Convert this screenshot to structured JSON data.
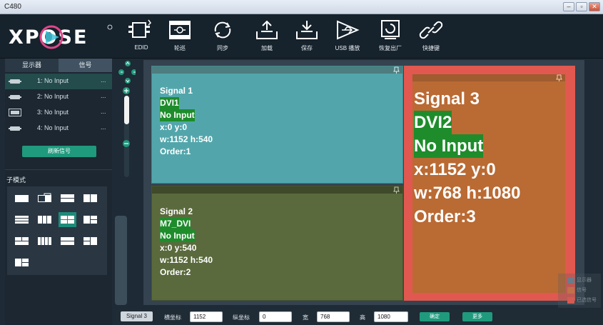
{
  "window": {
    "title": "C480"
  },
  "toolbar": {
    "logo_text": "XPOSE",
    "tools": [
      {
        "label": "EDID",
        "icon": "edid-icon"
      },
      {
        "label": "轮巡",
        "icon": "cycle-film-icon"
      },
      {
        "label": "同步",
        "icon": "sync-icon"
      },
      {
        "label": "加载",
        "icon": "load-icon"
      },
      {
        "label": "保存",
        "icon": "save-icon"
      },
      {
        "label": "USB 播放",
        "icon": "usb-play-icon"
      },
      {
        "label": "恢复出厂",
        "icon": "factory-reset-icon"
      },
      {
        "label": "快捷键",
        "icon": "shortcut-link-icon"
      }
    ]
  },
  "sidebar": {
    "tabs": [
      "显示器",
      "信号"
    ],
    "active_tab": "信号",
    "inputs": [
      {
        "label": "1: No Input",
        "more": "...",
        "icon": "hdmi-port-icon"
      },
      {
        "label": "2: No Input",
        "more": "...",
        "icon": "hdmi-port-icon"
      },
      {
        "label": "3: No Input",
        "more": "...",
        "icon": "vga-port-icon"
      },
      {
        "label": "4: No Input",
        "more": "...",
        "icon": "hdmi-port-icon"
      }
    ],
    "refresh_label": "刷新信号",
    "submode_title": "子模式"
  },
  "canvas": {
    "windows": [
      {
        "name": "Signal 1",
        "source": "DVI1",
        "status": "No Input",
        "pos": "x:0  y:0",
        "size": "w:1152  h:540",
        "order": "Order:1",
        "color": "#52a6ab"
      },
      {
        "name": "Signal 2",
        "source": "M7_DVI",
        "status": "No Input",
        "pos": "x:0  y:540",
        "size": "w:1152  h:540",
        "order": "Order:2",
        "color": "#5a6a3d"
      },
      {
        "name": "Signal 3",
        "source": "DVI2",
        "status": "No Input",
        "pos": "x:1152  y:0",
        "size": "w:768  h:1080",
        "order": "Order:3",
        "color": "#ba6a33"
      }
    ]
  },
  "bottom": {
    "selected_signal": "Signal 3",
    "x_label": "横坐标",
    "x_value": "1152",
    "y_label": "纵坐标",
    "y_value": "0",
    "w_label": "宽",
    "w_value": "768",
    "h_label": "高",
    "h_value": "1080",
    "confirm_label": "确定",
    "more_label": "更多"
  },
  "legend": {
    "items": [
      {
        "label": "显示器",
        "color": "#6d7a88"
      },
      {
        "label": "信号",
        "color": "#c2704a"
      },
      {
        "label": "已选信号",
        "color": "#d45a52"
      }
    ]
  },
  "colors": {
    "accent": "#1f9a7d",
    "highlight": "#1e8c2b",
    "selected_border": "#e0584f"
  }
}
